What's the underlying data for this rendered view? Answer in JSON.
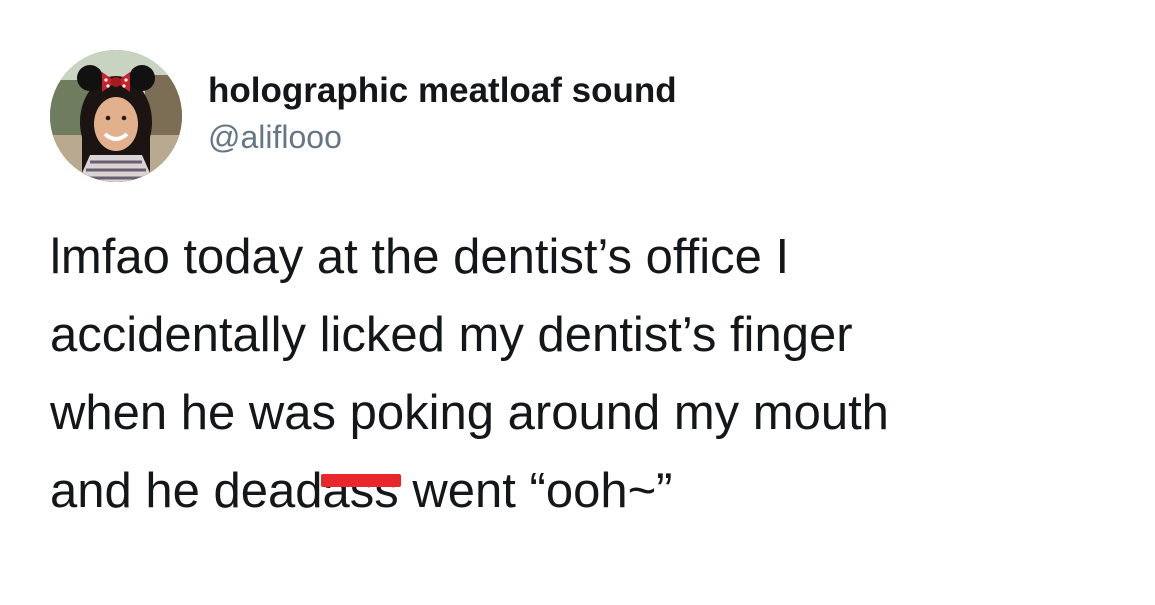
{
  "tweet": {
    "author": {
      "display_name": "holographic meatloaf sound",
      "handle": "@aliflooo",
      "avatar_icon": "profile-photo-avatar"
    },
    "text_lines": [
      "lmfao today at the dentist’s office I",
      "accidentally licked my dentist’s finger",
      "when he was poking around my mouth"
    ],
    "last_line": {
      "before": "and he dead",
      "redacted": "ass",
      "after": " went “ooh~”"
    },
    "colors": {
      "name": "#14171a",
      "handle": "#657786",
      "body": "#14171a",
      "redaction": "#e8262b",
      "background": "#ffffff"
    }
  }
}
